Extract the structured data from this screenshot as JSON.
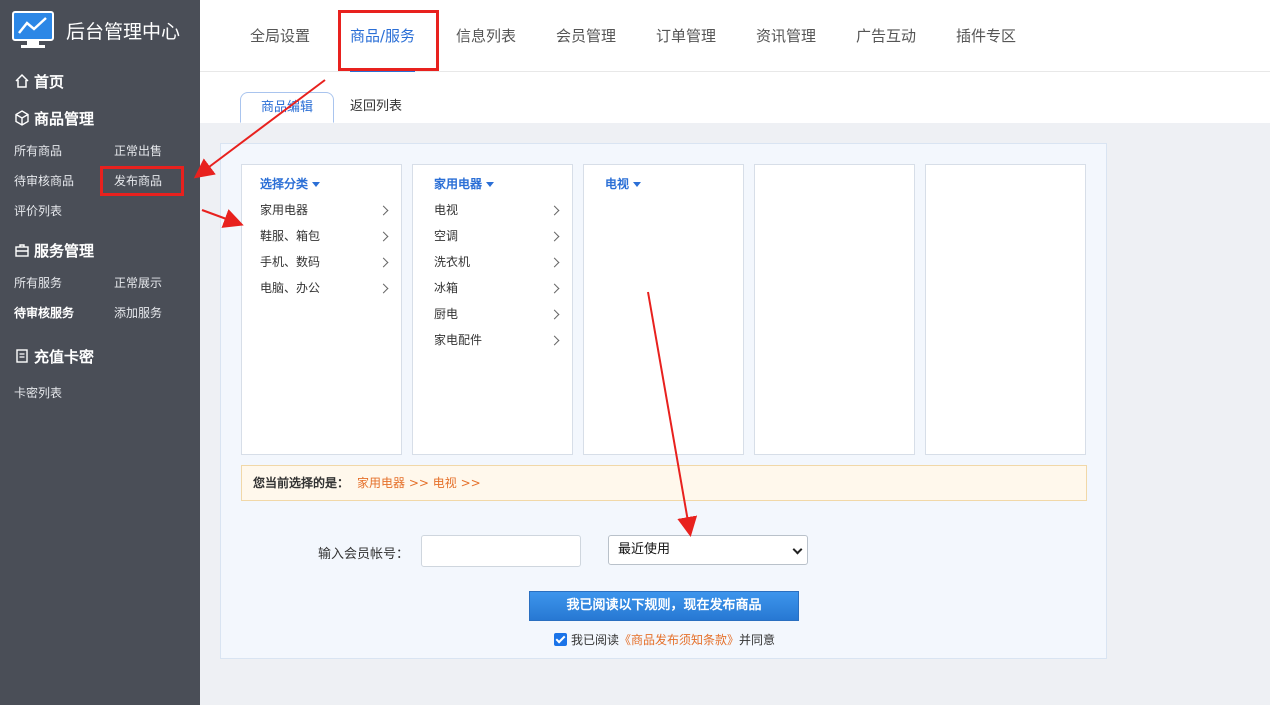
{
  "brand": {
    "title": "后台管理中心"
  },
  "sidebar": {
    "home": "首页",
    "groups": [
      {
        "title": "商品管理",
        "items": [
          "所有商品",
          "正常出售",
          "待审核商品",
          "发布商品",
          "评价列表"
        ]
      },
      {
        "title": "服务管理",
        "items": [
          "所有服务",
          "正常展示",
          "待审核服务",
          "添加服务"
        ]
      },
      {
        "title": "充值卡密",
        "items": [
          "卡密列表"
        ]
      }
    ]
  },
  "topnav": {
    "tabs": [
      "全局设置",
      "商品/服务",
      "信息列表",
      "会员管理",
      "订单管理",
      "资讯管理",
      "广告互动",
      "插件专区"
    ],
    "active": "商品/服务"
  },
  "subtabs": {
    "active": "商品编辑",
    "other": "返回列表"
  },
  "columns": {
    "c1": {
      "head": "选择分类",
      "items": [
        "家用电器",
        "鞋服、箱包",
        "手机、数码",
        "电脑、办公"
      ]
    },
    "c2": {
      "head": "家用电器",
      "items": [
        "电视",
        "空调",
        "洗衣机",
        "冰箱",
        "厨电",
        "家电配件"
      ]
    },
    "c3": {
      "head": "电视"
    }
  },
  "selection": {
    "label": "您当前选择的是：",
    "path": "家用电器 >> 电视 >>"
  },
  "member": {
    "label": "输入会员帐号：",
    "value": "",
    "select_value": "最近使用"
  },
  "publish": {
    "button": "我已阅读以下规则，现在发布商品",
    "agree_prefix": "我已阅读",
    "terms": "《商品发布须知条款》",
    "agree_suffix": "并同意"
  },
  "colors": {
    "sidebar_bg": "#4a4e57",
    "accent": "#2b6fd6",
    "highlight": "#e8211e",
    "orange": "#e5702a"
  }
}
